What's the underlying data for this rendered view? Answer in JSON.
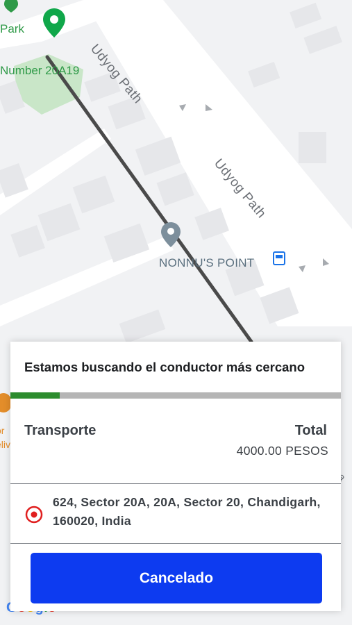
{
  "map": {
    "labels": {
      "park": "Park",
      "plot_number": "Number 20A19",
      "road_top": "Udyog Path",
      "road_mid": "Udyog Path",
      "poi": "NONNU'S POINT",
      "left_cut_1": "or",
      "left_cut_2": "eliv",
      "right_cut": "na"
    },
    "icons": [
      "green-location-pin",
      "gray-location-pin",
      "bus-stop",
      "restaurant",
      "one-way-arrows"
    ],
    "attribution": {
      "text": "Google",
      "letter_colors": [
        "#4285F4",
        "#EA4335",
        "#FBBC05",
        "#4285F4",
        "#34A853",
        "#EA4335"
      ]
    },
    "colors": {
      "route": "#4a4a4a",
      "park": "#c9e6c8",
      "pin_green": "#10a74a",
      "pin_gray": "#7d8f9c",
      "bus": "#1a73e8"
    }
  },
  "ride_request": {
    "status_text": "Estamos buscando el conductor más cercano",
    "search_progress": 0.15,
    "progress_color": "#2c8c2e",
    "service_label": "Transporte",
    "total_label": "Total",
    "total_amount": "4000.00 PESOS",
    "pickup_address": "624, Sector 20A, 20A, Sector 20, Chandigarh, 160020, India",
    "cancel_button_label": "Cancelado",
    "cancel_button_color": "#0d3bf0"
  }
}
